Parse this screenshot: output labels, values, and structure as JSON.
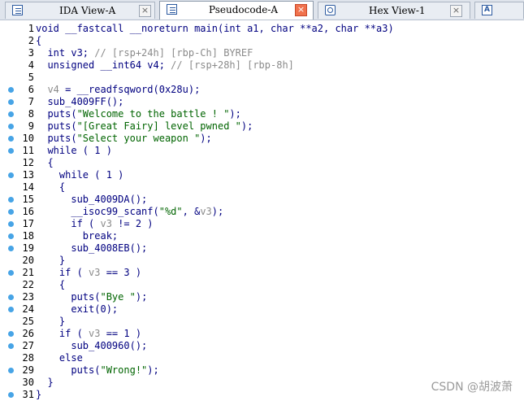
{
  "tabs": [
    {
      "label": "IDA View-A",
      "icon": "disassembly-view-icon",
      "active": false
    },
    {
      "label": "Pseudocode-A",
      "icon": "pseudocode-view-icon",
      "active": true
    },
    {
      "label": "Hex View-1",
      "icon": "hex-view-icon",
      "active": false
    },
    {
      "label": "A",
      "icon": "structures-view-icon",
      "active": false
    }
  ],
  "code": [
    {
      "n": "1",
      "bp": false,
      "t": [
        [
          "k",
          "void __fastcall __noreturn main(int a1, char **a2, char **a3)"
        ]
      ]
    },
    {
      "n": "2",
      "bp": false,
      "t": [
        [
          "k",
          "{"
        ]
      ]
    },
    {
      "n": "3",
      "bp": false,
      "t": [
        [
          "k",
          "  int v3; "
        ],
        [
          "c",
          "// [rsp+24h] [rbp-Ch] BYREF"
        ]
      ]
    },
    {
      "n": "4",
      "bp": false,
      "t": [
        [
          "k",
          "  unsigned __int64 v4; "
        ],
        [
          "c",
          "// [rsp+28h] [rbp-8h]"
        ]
      ]
    },
    {
      "n": "5",
      "bp": false,
      "t": [
        [
          "k",
          ""
        ]
      ]
    },
    {
      "n": "6",
      "bp": true,
      "t": [
        [
          "v",
          "  v4"
        ],
        [
          "k",
          " = __readfsqword(0x28u);"
        ]
      ]
    },
    {
      "n": "7",
      "bp": true,
      "t": [
        [
          "k",
          "  sub_4009FF();"
        ]
      ]
    },
    {
      "n": "8",
      "bp": true,
      "t": [
        [
          "k",
          "  puts("
        ],
        [
          "s",
          "\"Welcome to the battle ! \""
        ],
        [
          "k",
          ");"
        ]
      ]
    },
    {
      "n": "9",
      "bp": true,
      "t": [
        [
          "k",
          "  puts("
        ],
        [
          "s",
          "\"[Great Fairy] level pwned \""
        ],
        [
          "k",
          ");"
        ]
      ]
    },
    {
      "n": "10",
      "bp": true,
      "t": [
        [
          "k",
          "  puts("
        ],
        [
          "s",
          "\"Select your weapon \""
        ],
        [
          "k",
          ");"
        ]
      ]
    },
    {
      "n": "11",
      "bp": true,
      "t": [
        [
          "k",
          "  while ( 1 )"
        ]
      ]
    },
    {
      "n": "12",
      "bp": false,
      "t": [
        [
          "k",
          "  {"
        ]
      ]
    },
    {
      "n": "13",
      "bp": true,
      "t": [
        [
          "k",
          "    while ( 1 )"
        ]
      ]
    },
    {
      "n": "14",
      "bp": false,
      "t": [
        [
          "k",
          "    {"
        ]
      ]
    },
    {
      "n": "15",
      "bp": true,
      "t": [
        [
          "k",
          "      sub_4009DA();"
        ]
      ]
    },
    {
      "n": "16",
      "bp": true,
      "t": [
        [
          "k",
          "      __isoc99_scanf("
        ],
        [
          "s",
          "\"%d\""
        ],
        [
          "k",
          ", &"
        ],
        [
          "v",
          "v3"
        ],
        [
          "k",
          ");"
        ]
      ]
    },
    {
      "n": "17",
      "bp": true,
      "t": [
        [
          "k",
          "      if ( "
        ],
        [
          "v",
          "v3"
        ],
        [
          "k",
          " != 2 )"
        ]
      ]
    },
    {
      "n": "18",
      "bp": true,
      "t": [
        [
          "k",
          "        break;"
        ]
      ]
    },
    {
      "n": "19",
      "bp": true,
      "t": [
        [
          "k",
          "      sub_4008EB();"
        ]
      ]
    },
    {
      "n": "20",
      "bp": false,
      "t": [
        [
          "k",
          "    }"
        ]
      ]
    },
    {
      "n": "21",
      "bp": true,
      "t": [
        [
          "k",
          "    if ( "
        ],
        [
          "v",
          "v3"
        ],
        [
          "k",
          " == 3 )"
        ]
      ]
    },
    {
      "n": "22",
      "bp": false,
      "t": [
        [
          "k",
          "    {"
        ]
      ]
    },
    {
      "n": "23",
      "bp": true,
      "t": [
        [
          "k",
          "      puts("
        ],
        [
          "s",
          "\"Bye \""
        ],
        [
          "k",
          ");"
        ]
      ]
    },
    {
      "n": "24",
      "bp": true,
      "t": [
        [
          "k",
          "      exit(0);"
        ]
      ]
    },
    {
      "n": "25",
      "bp": false,
      "t": [
        [
          "k",
          "    }"
        ]
      ]
    },
    {
      "n": "26",
      "bp": true,
      "t": [
        [
          "k",
          "    if ( "
        ],
        [
          "v",
          "v3"
        ],
        [
          "k",
          " == 1 )"
        ]
      ]
    },
    {
      "n": "27",
      "bp": true,
      "t": [
        [
          "k",
          "      sub_400960();"
        ]
      ]
    },
    {
      "n": "28",
      "bp": false,
      "t": [
        [
          "k",
          "    else"
        ]
      ]
    },
    {
      "n": "29",
      "bp": true,
      "t": [
        [
          "k",
          "      puts("
        ],
        [
          "s",
          "\"Wrong!\""
        ],
        [
          "k",
          ");"
        ]
      ]
    },
    {
      "n": "30",
      "bp": false,
      "t": [
        [
          "k",
          "  }"
        ]
      ]
    },
    {
      "n": "31",
      "bp": true,
      "t": [
        [
          "k",
          "}"
        ]
      ]
    }
  ],
  "watermark": "CSDN @胡波萧",
  "colors": {
    "keyword": "#000080",
    "comment": "#8b8b8b",
    "string": "#006400",
    "breakpoint": "#47a4e6",
    "active_close": "#f0724d"
  }
}
